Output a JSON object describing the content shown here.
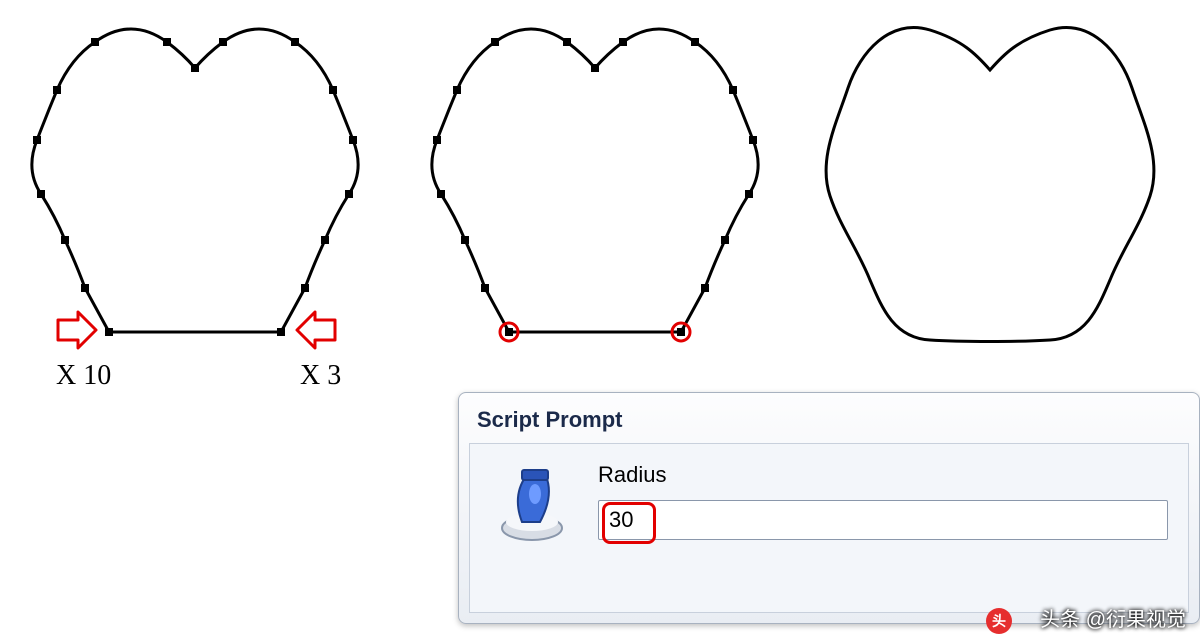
{
  "annotations": {
    "left_marker": "X 10",
    "right_marker": "X 3"
  },
  "dialog": {
    "title": "Script Prompt",
    "field_label": "Radius",
    "field_value": "30"
  },
  "watermark": {
    "logo_glyph": "头",
    "text": "头条 @衍果视觉"
  },
  "icons": {
    "script_icon": "script-paint-icon",
    "arrow_left": "arrow-right-icon",
    "arrow_right": "arrow-left-icon"
  }
}
